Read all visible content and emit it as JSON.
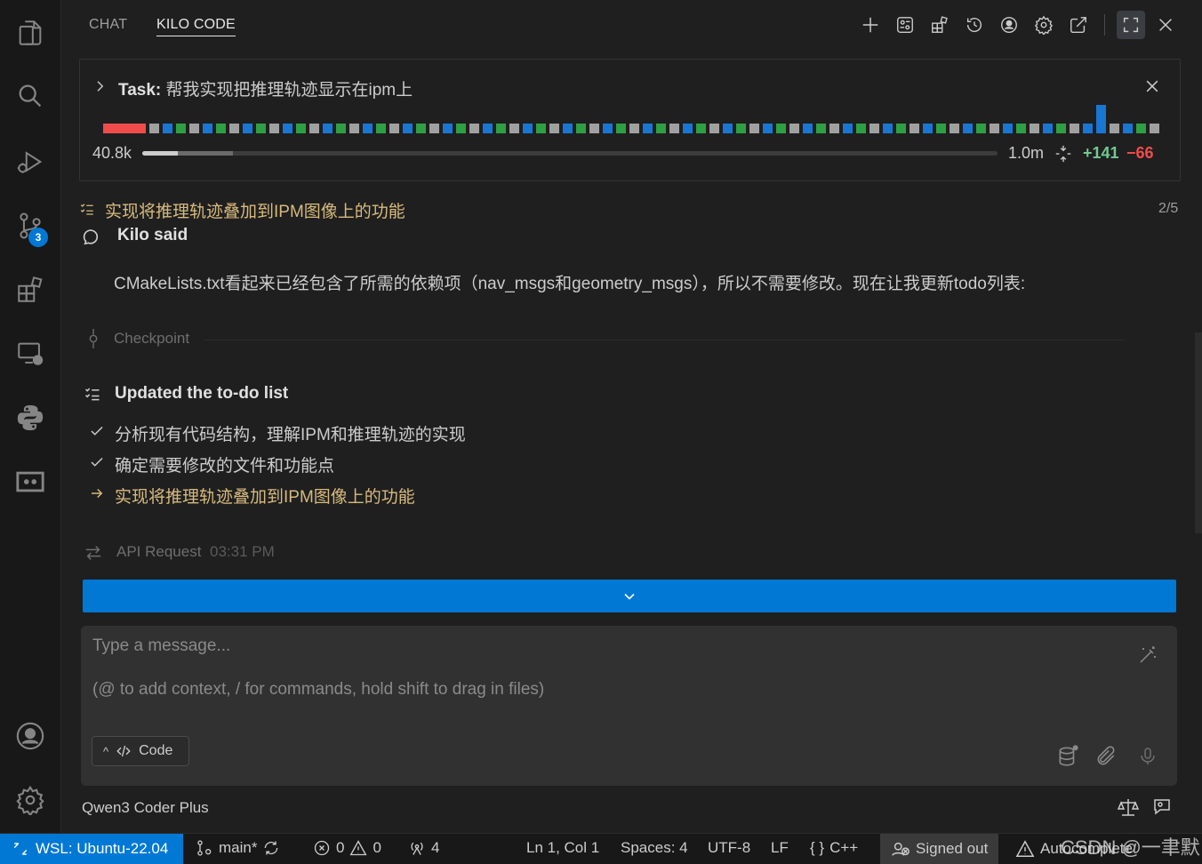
{
  "tabs": {
    "chat": "CHAT",
    "kilo": "KILO CODE"
  },
  "task": {
    "prefix": "Task:",
    "text": "帮我实现把推理轨迹显示在ipm上",
    "context_used": "40.8k",
    "context_max": "1.0m",
    "added": "+141",
    "removed": "−66",
    "context_fill": 0.1
  },
  "todo_header": {
    "title": "实现将推理轨迹叠加到IPM图像上的功能",
    "progress": "2/5"
  },
  "message": {
    "author": "Kilo said",
    "text": "CMakeLists.txt看起来已经包含了所需的依赖项（nav_msgs和geometry_msgs），所以不需要修改。现在让我更新todo列表:"
  },
  "checkpoint": {
    "label": "Checkpoint"
  },
  "todo_update": {
    "title": "Updated the to-do list",
    "items": [
      {
        "text": "分析现有代码结构，理解IPM和推理轨迹的实现",
        "status": "done"
      },
      {
        "text": "确定需要修改的文件和功能点",
        "status": "done"
      },
      {
        "text": "实现将推理轨迹叠加到IPM图像上的功能",
        "status": "in-progress"
      }
    ]
  },
  "api_request": {
    "label": "API Request",
    "time": "03:31 PM"
  },
  "input": {
    "placeholder": "Type a message...",
    "hint": "(@ to add context, / for commands, hold shift to drag in files)",
    "mode": "Code"
  },
  "model": "Qwen3 Coder Plus",
  "statusbar": {
    "remote": "WSL: Ubuntu-22.04",
    "branch": "main*",
    "errors": "0",
    "warnings": "0",
    "ports": "4",
    "position": "Ln 1, Col 1",
    "spaces": "Spaces: 4",
    "encoding": "UTF-8",
    "eol": "LF",
    "language": "C++",
    "account": "Signed out",
    "autocomplete": "Autocomplete"
  },
  "watermark": "CSDN @一聿默",
  "colors": {
    "accent": "#0078d4",
    "todo_yellow": "#d7ba7d",
    "added_green": "#73c991",
    "removed_red": "#f14c4c",
    "segment_gray": "#a0a0a0",
    "segment_blue": "#1976d2",
    "segment_green": "#2ea043"
  },
  "icons": {
    "activity_bar": [
      "explorer-icon",
      "search-icon",
      "run-debug-icon",
      "source-control-icon",
      "extensions-icon",
      "remote-explorer-icon",
      "python-icon",
      "kilo-code-icon",
      "account-icon",
      "settings-icon"
    ],
    "header": [
      "plus-icon",
      "history-board-icon",
      "marketplace-icon",
      "history-icon",
      "account-circle-icon",
      "settings-icon",
      "open-external-icon",
      "fullscreen-icon",
      "close-icon"
    ]
  }
}
